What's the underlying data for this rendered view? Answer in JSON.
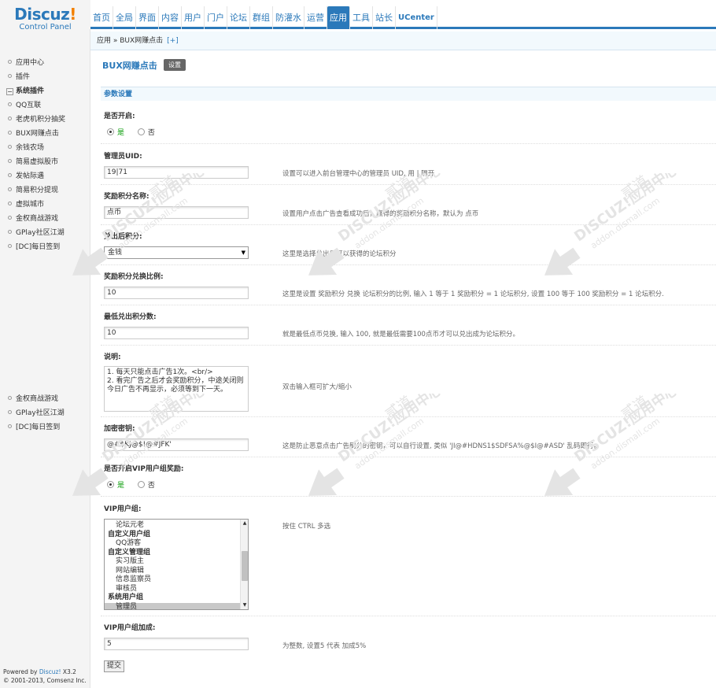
{
  "logo": {
    "name": "Discuz",
    "bang": "!",
    "sub": "Control Panel"
  },
  "nav": [
    "首页",
    "全局",
    "界面",
    "内容",
    "用户",
    "门户",
    "论坛",
    "群组",
    "防灌水",
    "运营",
    "应用",
    "工具",
    "站长",
    "UCenter"
  ],
  "nav_active": "应用",
  "sidebar": {
    "links_top": [
      "应用中心",
      "插件"
    ],
    "category": "系统插件",
    "category_toggle": "−",
    "links_mid": [
      "QQ互联",
      "老虎机积分抽奖",
      "BUX网赚点击",
      "余钱农场",
      "简易虚拟股市",
      "发帖际遇",
      "简易积分提现",
      "虚拟城市",
      "金权商战游戏",
      "GPlay社区江湖",
      "[DC]每日签到"
    ],
    "links_bottom": [
      "金权商战游戏",
      "GPlay社区江湖",
      "[DC]每日签到"
    ]
  },
  "footer": {
    "powered_prefix": "Powered by ",
    "powered_brand": "Discuz!",
    "powered_ver": " X3.2",
    "copyright": "© 2001-2013, Comsenz Inc."
  },
  "breadcrumb": {
    "path": "应用 » BUX网赚点击",
    "plus": "[+]"
  },
  "plugin_title": "BUX网赚点击",
  "settings_tab": "设置",
  "section_header": "参数设置",
  "form": {
    "enable": {
      "label": "是否开启:",
      "yes": "是",
      "no": "否"
    },
    "admin_uid": {
      "label": "管理员UID:",
      "value": "19|71",
      "comment": "设置可以进入前台管理中心的管理员 UID, 用 | 隔开"
    },
    "credit_name": {
      "label": "奖励积分名称:",
      "value": "点币",
      "comment": "设置用户点击广告查看成功后，赢得的奖励积分名称，默认为 点币"
    },
    "exchange_credit": {
      "label": "兑出后积分:",
      "value": "金钱",
      "comment": "这里是选择兑出后可以获得的论坛积分"
    },
    "ratio": {
      "label": "奖励积分兑换比例:",
      "value": "10",
      "comment": "这里是设置 奖励积分 兑换 论坛积分的比例, 输入 1 等于 1 奖励积分 = 1 论坛积分, 设置 100 等于 100 奖励积分 = 1 论坛积分."
    },
    "min_exchange": {
      "label": "最低兑出积分数:",
      "value": "10",
      "comment": "就是最低点币兑换, 输入 100, 就是最低需要100点币才可以兑出成为论坛积分。"
    },
    "description": {
      "label": "说明:",
      "value": "1. 每天只能点击广告1次。<br/>\n2. 看完广告之后才会奖励积分，中途关闭则今日广告不再显示，必须等到下一天。",
      "comment": "双击输入框可扩大/缩小"
    },
    "secret_key": {
      "label": "加密密钥:",
      "value": "@#$KJ@$!@#JFK'",
      "comment": "这是防止恶意点击广告刷分的密钥，可以自行设置, 类似 'JI@#HDNS1$SDFSA%@$I@#ASD' 乱码即行。"
    },
    "vip_enable": {
      "label": "是否开启VIP用户组奖励:",
      "yes": "是",
      "no": "否"
    },
    "vip_groups": {
      "label": "VIP用户组:",
      "comment": "按住 CTRL 多选",
      "options": [
        {
          "text": "论坛元老",
          "type": "sub"
        },
        {
          "text": "自定义用户组",
          "type": "grp"
        },
        {
          "text": "QQ游客",
          "type": "sub"
        },
        {
          "text": "自定义管理组",
          "type": "grp"
        },
        {
          "text": "实习版主",
          "type": "sub"
        },
        {
          "text": "网站编辑",
          "type": "sub"
        },
        {
          "text": "信息监察员",
          "type": "sub"
        },
        {
          "text": "审核员",
          "type": "sub"
        },
        {
          "text": "系统用户组",
          "type": "grp"
        },
        {
          "text": "管理员",
          "type": "sub",
          "selected": true
        }
      ]
    },
    "vip_bonus": {
      "label": "VIP用户组加成:",
      "value": "5",
      "comment": "为整数, 设置5 代表 加成5%"
    },
    "submit": "提交"
  },
  "watermark": {
    "line1": "DISCUZ!应用中心",
    "line2": "addon.dismall.com",
    "line3": "贰道"
  }
}
